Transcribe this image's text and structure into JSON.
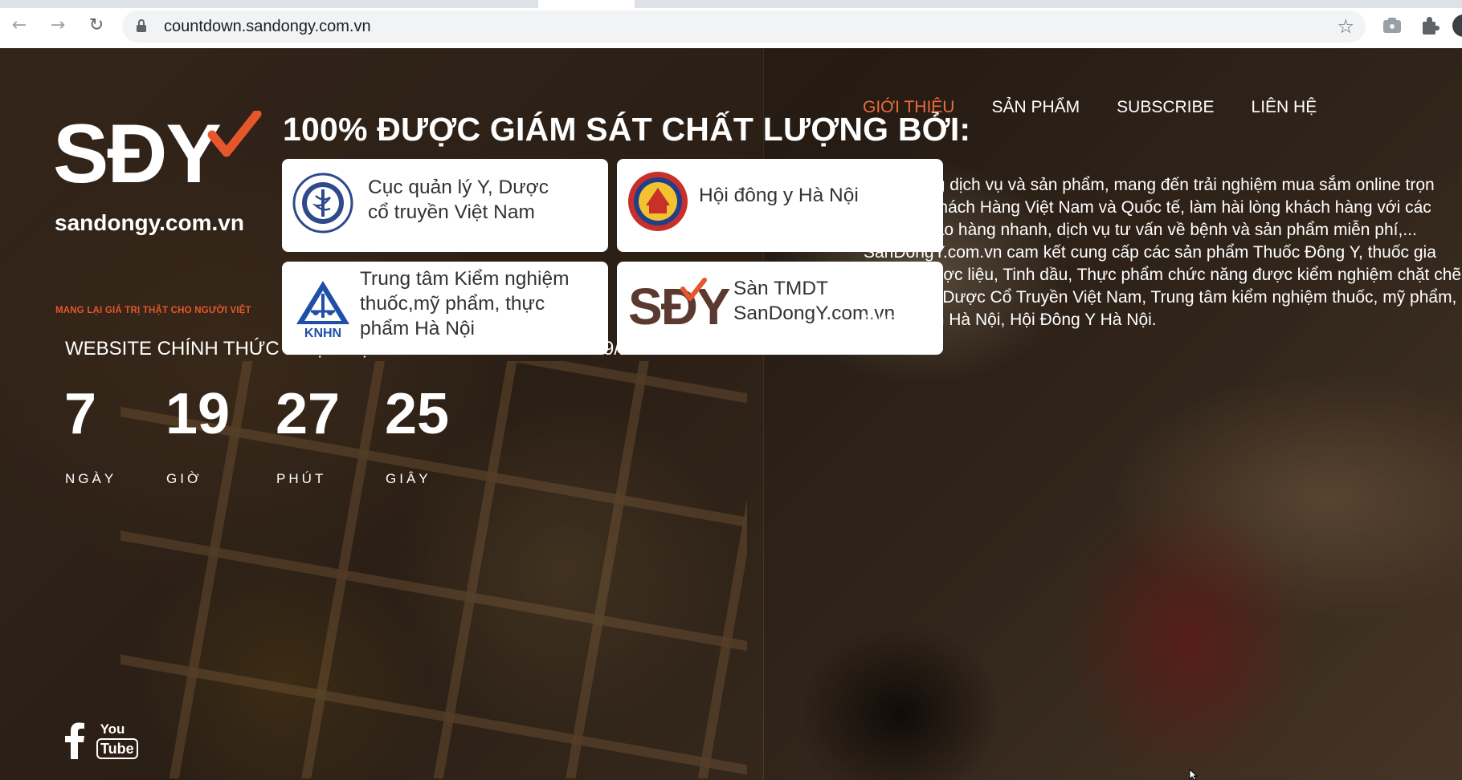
{
  "browser": {
    "url": "countdown.sandongy.com.vn",
    "icons": {
      "back": "back-arrow-icon",
      "forward": "forward-arrow-icon",
      "reload": "reload-icon",
      "lock": "lock-icon",
      "bookmark": "star-icon",
      "camera": "camera-icon",
      "extensions": "puzzle-icon"
    }
  },
  "logo": {
    "mark": "SĐY",
    "domain": "sandongy.com.vn",
    "slogan": "MANG LẠI GIÁ TRỊ THẬT CHO NGƯỜI VIỆT",
    "accent_color": "#e5572b"
  },
  "nav": {
    "items": [
      {
        "label": "GIỚI THIỆU",
        "active": true
      },
      {
        "label": "SẢN PHẨM",
        "active": false
      },
      {
        "label": "SUBSCRIBE",
        "active": false
      },
      {
        "label": "LIÊN HỆ",
        "active": false
      }
    ],
    "active_color": "#ee6a3e"
  },
  "quality": {
    "heading": "100% ĐƯỢC GIÁM SÁT CHẤT LƯỢNG BỞI:",
    "certs": [
      {
        "lines": [
          "Cục quản lý Y, Dược",
          "cổ truyền Việt Nam"
        ],
        "icon": "ministry-seal-icon"
      },
      {
        "lines": [
          "Hội đông y Hà Nội"
        ],
        "icon": "hanoi-association-seal-icon"
      },
      {
        "lines": [
          "Trung tâm Kiểm nghiệm",
          "thuốc,mỹ phẩm, thực",
          "phẩm Hà Nội"
        ],
        "icon": "knhn-logo-icon",
        "logo_text": "KNHN"
      },
      {
        "lines": [
          "Sàn TMDT",
          "SanDongY.com.vn"
        ],
        "icon": "sdy-logo-icon",
        "logo_text": "SĐY"
      }
    ]
  },
  "intro": {
    "text": "chất lượng dịch vụ và sản phẩm, mang đến trải nghiệm mua sắm online trọn vẹn cho Khách Hàng Việt Nam và Quốc tế, làm hài lòng khách hàng với các dịch vụ giao hàng nhanh, dịch vụ tư vấn về bệnh và sản phẩm miễn phí,... SanDongY.com.vn cam kết cung cấp các sản phẩm Thuốc Đông Y, thuốc gia truyền, Dược liệu, Tinh dầu, Thực phẩm chức năng được kiểm nghiệm chặt chẽ bởi Cục Y Dược Cổ Truyền Việt Nam, Trung tâm kiểm nghiệm thuốc, mỹ phẩm, thực phẩm Hà Nội, Hội Đông Y Hà Nội."
  },
  "launch": {
    "note": "WEBSITE CHÍNH THỨC HOẠT ĐỘNG VÀO 10:00 NGÀY 25/09/2020"
  },
  "countdown": [
    {
      "value": "7",
      "label": "NGÀY"
    },
    {
      "value": "19",
      "label": "GIỜ"
    },
    {
      "value": "27",
      "label": "PHÚT"
    },
    {
      "value": "25",
      "label": "GIÂY"
    }
  ],
  "social": {
    "facebook": "facebook-icon",
    "youtube_top": "You",
    "youtube_bottom": "Tube"
  }
}
